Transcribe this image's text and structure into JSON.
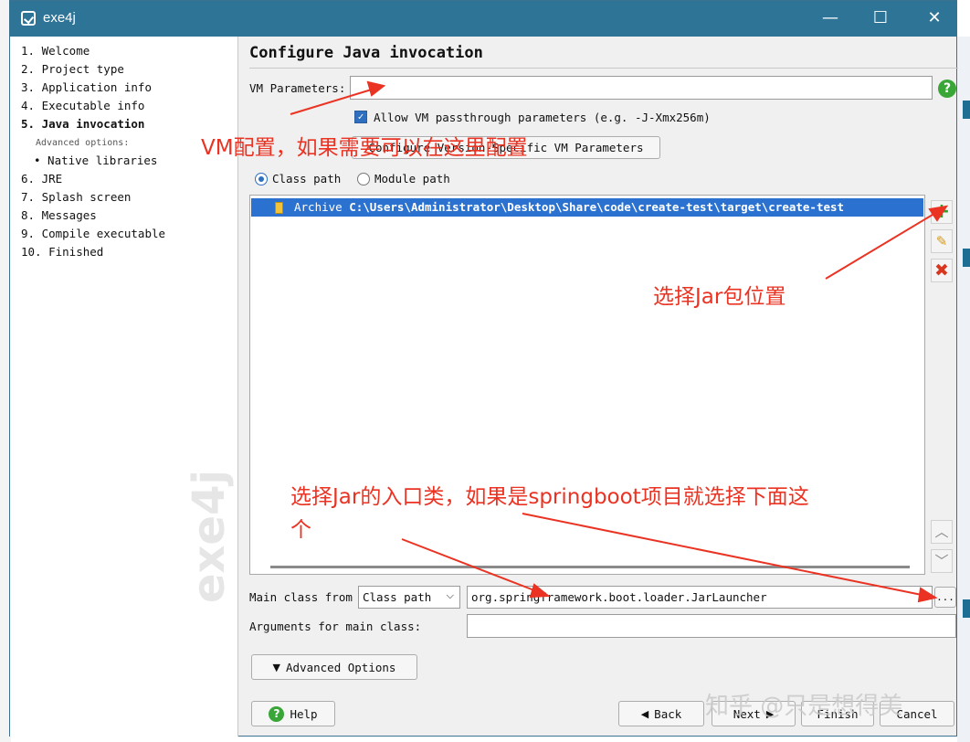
{
  "window": {
    "title": "exe4j",
    "minimize_glyph": "—",
    "maximize_glyph": "☐",
    "close_glyph": "✕"
  },
  "sidebar": {
    "steps": [
      {
        "label": "1. Welcome"
      },
      {
        "label": "2. Project type"
      },
      {
        "label": "3. Application info"
      },
      {
        "label": "4. Executable info"
      },
      {
        "label": "5. Java invocation",
        "active": true
      },
      {
        "label": "6. JRE"
      },
      {
        "label": "7. Splash screen"
      },
      {
        "label": "8. Messages"
      },
      {
        "label": "9. Compile executable"
      },
      {
        "label": "10. Finished"
      }
    ],
    "advanced_options_label": "Advanced options:",
    "native_libraries_label": "• Native libraries",
    "watermark": "exe4j"
  },
  "main": {
    "title": "Configure Java invocation",
    "vm_parameters_label": "VM Parameters:",
    "vm_parameters_value": "",
    "allow_passthrough_label": "Allow VM passthrough parameters (e.g. -J-Xmx256m)",
    "allow_passthrough_checked": true,
    "configure_version_button": "Configure Version-Specific VM Parameters",
    "class_path_radio": "Class path",
    "module_path_radio": "Module path",
    "selected_path_mode": "Class path",
    "classpath_entries": [
      {
        "type": "Archive",
        "path": "C:\\Users\\Administrator\\Desktop\\Share\\code\\create-test\\target\\create-test"
      }
    ],
    "main_class_from_label": "Main class from",
    "main_class_source": "Class path",
    "main_class_value": "org.springframework.boot.loader.JarLauncher",
    "browse_label": "...",
    "arguments_label": "Arguments for main class:",
    "arguments_value": "",
    "advanced_options_button": "Advanced Options"
  },
  "footer": {
    "help_button": "Help",
    "back_button": "Back",
    "next_button": "Next",
    "finish_button": "Finish",
    "cancel_button": "Cancel"
  },
  "annotations": {
    "vm_config": "VM配置，如果需要可以在这里配置",
    "select_jar": "选择Jar包位置",
    "select_entry_line1": "选择Jar的入口类，如果是springboot项目就选择下面这",
    "select_entry_line2": "个",
    "arrow_color": "#ea3323"
  },
  "watermark_text": "知乎 @只是想得美",
  "colors": {
    "titlebar": "#2e7497",
    "selection": "#2b72d0",
    "annotation": "#ea3323",
    "help_green": "#3aa637"
  }
}
